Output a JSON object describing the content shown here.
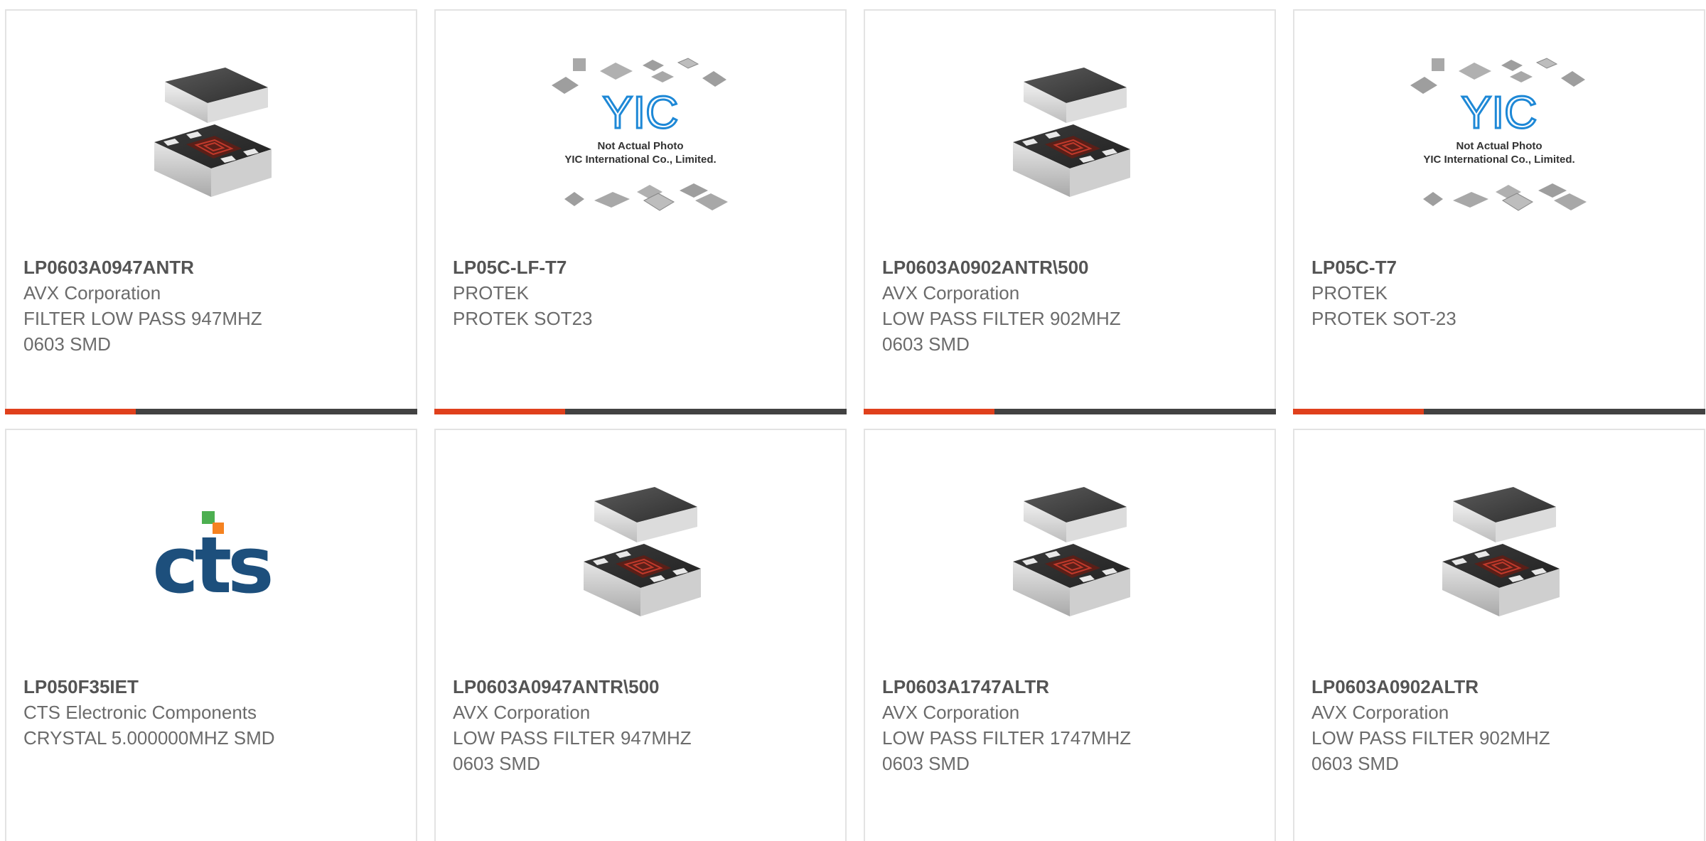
{
  "colors": {
    "accent": "#e0401c",
    "bar": "#424242",
    "border": "#e3e3e3",
    "text": "#6b6b6b",
    "cts_blue": "#1d4f7c",
    "cts_green": "#4caf50",
    "cts_orange": "#f58220",
    "yic_blue": "#1e88d6"
  },
  "products": [
    {
      "part_number": "LP0603A0947ANTR",
      "manufacturer": "AVX Corporation",
      "desc1": "FILTER LOW PASS 947MHZ",
      "desc2": "0603 SMD",
      "image": "avx-chip-filter"
    },
    {
      "part_number": "LP05C-LF-T7",
      "manufacturer": "PROTEK",
      "desc1": "PROTEK SOT23",
      "desc2": "",
      "image": "yic-not-actual-photo",
      "image_text": {
        "logo": "YIC",
        "line1": "Not Actual Photo",
        "line2": "YIC International Co., Limited."
      }
    },
    {
      "part_number": "LP0603A0902ANTR\\500",
      "manufacturer": "AVX Corporation",
      "desc1": "LOW PASS FILTER 902MHZ",
      "desc2": "0603 SMD",
      "image": "avx-chip-filter"
    },
    {
      "part_number": "LP05C-T7",
      "manufacturer": "PROTEK",
      "desc1": "PROTEK SOT-23",
      "desc2": "",
      "image": "yic-not-actual-photo",
      "image_text": {
        "logo": "YIC",
        "line1": "Not Actual Photo",
        "line2": "YIC International Co., Limited."
      }
    },
    {
      "part_number": "LP050F35IET",
      "manufacturer": "CTS Electronic Components",
      "desc1": "CRYSTAL 5.000000MHZ SMD",
      "desc2": "",
      "image": "cts-logo",
      "image_text": {
        "logo": "cts"
      }
    },
    {
      "part_number": "LP0603A0947ANTR\\500",
      "manufacturer": "AVX Corporation",
      "desc1": "LOW PASS FILTER 947MHZ",
      "desc2": "0603 SMD",
      "image": "avx-chip-filter"
    },
    {
      "part_number": "LP0603A1747ALTR",
      "manufacturer": "AVX Corporation",
      "desc1": "LOW PASS FILTER 1747MHZ",
      "desc2": "0603 SMD",
      "image": "avx-chip-filter"
    },
    {
      "part_number": "LP0603A0902ALTR",
      "manufacturer": "AVX Corporation",
      "desc1": "LOW PASS FILTER 902MHZ",
      "desc2": "0603 SMD",
      "image": "avx-chip-filter"
    }
  ]
}
